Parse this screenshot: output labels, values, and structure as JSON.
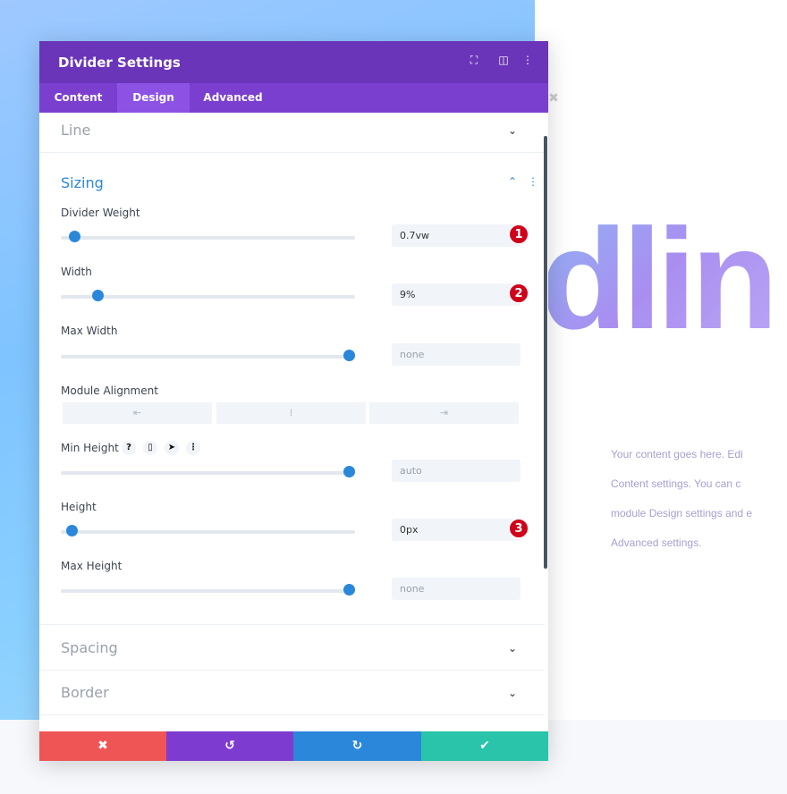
{
  "panel": {
    "title": "Divider Settings",
    "header_icons": [
      "expand-icon",
      "split-view-icon",
      "more-vertical-icon"
    ],
    "tabs": [
      {
        "label": "Content"
      },
      {
        "label": "Design",
        "active": true
      },
      {
        "label": "Advanced"
      }
    ],
    "sections": {
      "line": "Line",
      "sizing": "Sizing",
      "spacing": "Spacing",
      "border": "Border"
    },
    "fields": [
      {
        "label": "Divider Weight",
        "value": "0.7vw",
        "slider_fraction": 0.03,
        "badge": "1",
        "placeholder": false
      },
      {
        "label": "Width",
        "value": "9%",
        "slider_fraction": 0.11,
        "badge": "2",
        "placeholder": false
      },
      {
        "label": "Max Width",
        "value": "none",
        "slider_fraction": 1,
        "badge": "",
        "placeholder": true
      },
      {
        "label": "Min Height",
        "value": "auto",
        "slider_fraction": 1,
        "badge": "",
        "placeholder": true
      },
      {
        "label": "Height",
        "value": "0px",
        "slider_fraction": 0.02,
        "badge": "3",
        "placeholder": false
      },
      {
        "label": "Max Height",
        "value": "none",
        "slider_fraction": 1,
        "badge": "",
        "placeholder": true
      }
    ],
    "module_alignment": {
      "label": "Module Alignment",
      "options": [
        "⇤",
        "⁞",
        "⇥"
      ]
    },
    "min_height_icons": {
      "help": "?",
      "device": "▯",
      "hover": "➤",
      "more": "⋮"
    },
    "footer": {
      "cancel": "✖",
      "undo": "↺",
      "redo": "↻",
      "save": "✔"
    },
    "colors": {
      "header": "#6a35b8",
      "tabs": "#7b3fd0",
      "cancel": "#ef5555",
      "undo": "#7e3bd0",
      "redo": "#2b87da",
      "save": "#29c4a9",
      "accent": "#2b87da",
      "badge": "#d0021b"
    }
  },
  "page": {
    "heading_fragment": "dlin",
    "paragraph_lines": [
      "Your content goes here. Edi",
      "Content settings. You can c",
      "module Design settings and e",
      "Advanced settings."
    ]
  }
}
